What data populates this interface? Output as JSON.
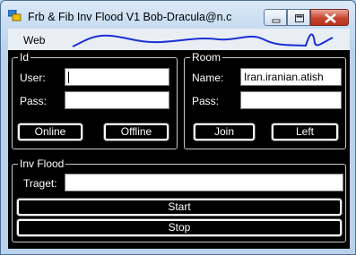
{
  "window": {
    "title": "Frb & Fib Inv Flood V1 Bob-Dracula@n.c"
  },
  "menu": {
    "items": [
      {
        "label": "Web"
      }
    ]
  },
  "id_group": {
    "title": "Id",
    "user_label": "User:",
    "user_value": "",
    "pass_label": "Pass:",
    "pass_value": "",
    "online_label": "Online",
    "offline_label": "Offline"
  },
  "room_group": {
    "title": "Room",
    "name_label": "Name:",
    "name_value": "Iran.iranian.atish",
    "pass_label": "Pass:",
    "pass_value": "",
    "join_label": "Join",
    "left_label": "Left"
  },
  "flood_group": {
    "title": "Inv Flood",
    "target_label": "Traget:",
    "target_value": "",
    "start_label": "Start",
    "stop_label": "Stop"
  },
  "colors": {
    "client_bg": "#000000",
    "scribble": "#1a2fd6",
    "close_button": "#c7442e"
  }
}
